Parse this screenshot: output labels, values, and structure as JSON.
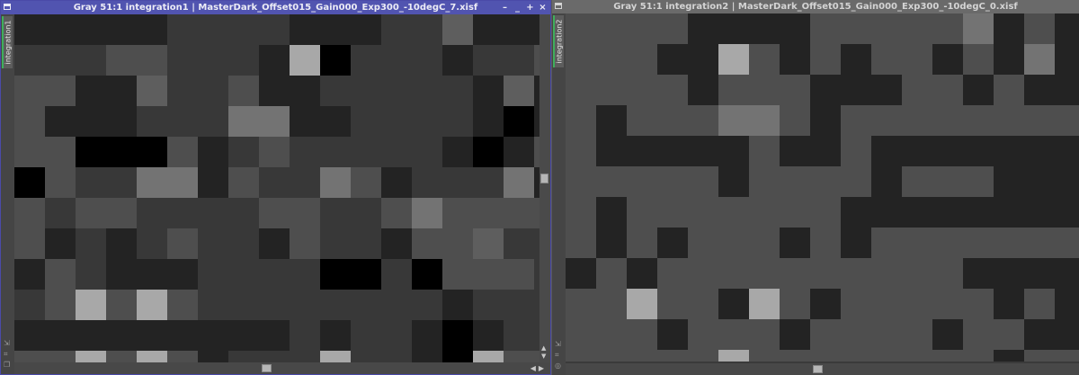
{
  "windows": [
    {
      "title": "Gray 51:1 integration1 | MasterDark_Offset015_Gain000_Exp300_-10degC_7.xisf",
      "side_tab": "integration1",
      "active": true,
      "cols": 17,
      "rows": 12,
      "pixel_levels": [
        "1111133331113341111",
        "333553331A03331335",
        "5511433511333331413",
        "5111333661133331013",
        "55000513533333101",
        "0533661533651333614",
        "5355333355335655555",
        "5131353315331554333",
        "1531113333003055533",
        "35A5A5333333331333A3",
        "1111111113133101333",
        "55A5A51333A3310A5545"
      ]
    },
    {
      "title": "Gray 51:1 integration2 | MasterDark_Offset015_Gain000_Exp300_-10degC_0.xisf",
      "side_tab": "integration2",
      "active": false,
      "cols": 17,
      "rows": 12,
      "pixel_levels": [
        "55551111555556151",
        "55511A515155151615",
        "5555155511155151151",
        "5155566515555555551",
        "5111115115111111115",
        "5555515555155511155",
        "5155555551111111115",
        "5151555151555555555",
        "1515555555555111155",
        "55A551A515555515155",
        "55515551555515511615",
        "55555A5555555515555"
      ]
    }
  ],
  "level_colors": {
    "0": "#000000",
    "1": "#232323",
    "3": "#383838",
    "4": "#5e5e5e",
    "5": "#4e4e4e",
    "6": "#737373",
    "A": "#a8a8a8"
  },
  "title_buttons": [
    "–",
    "_",
    "+",
    "×"
  ],
  "side_tool_icons": [
    "arrow-icon",
    "fit-icon",
    "layers-icon"
  ]
}
